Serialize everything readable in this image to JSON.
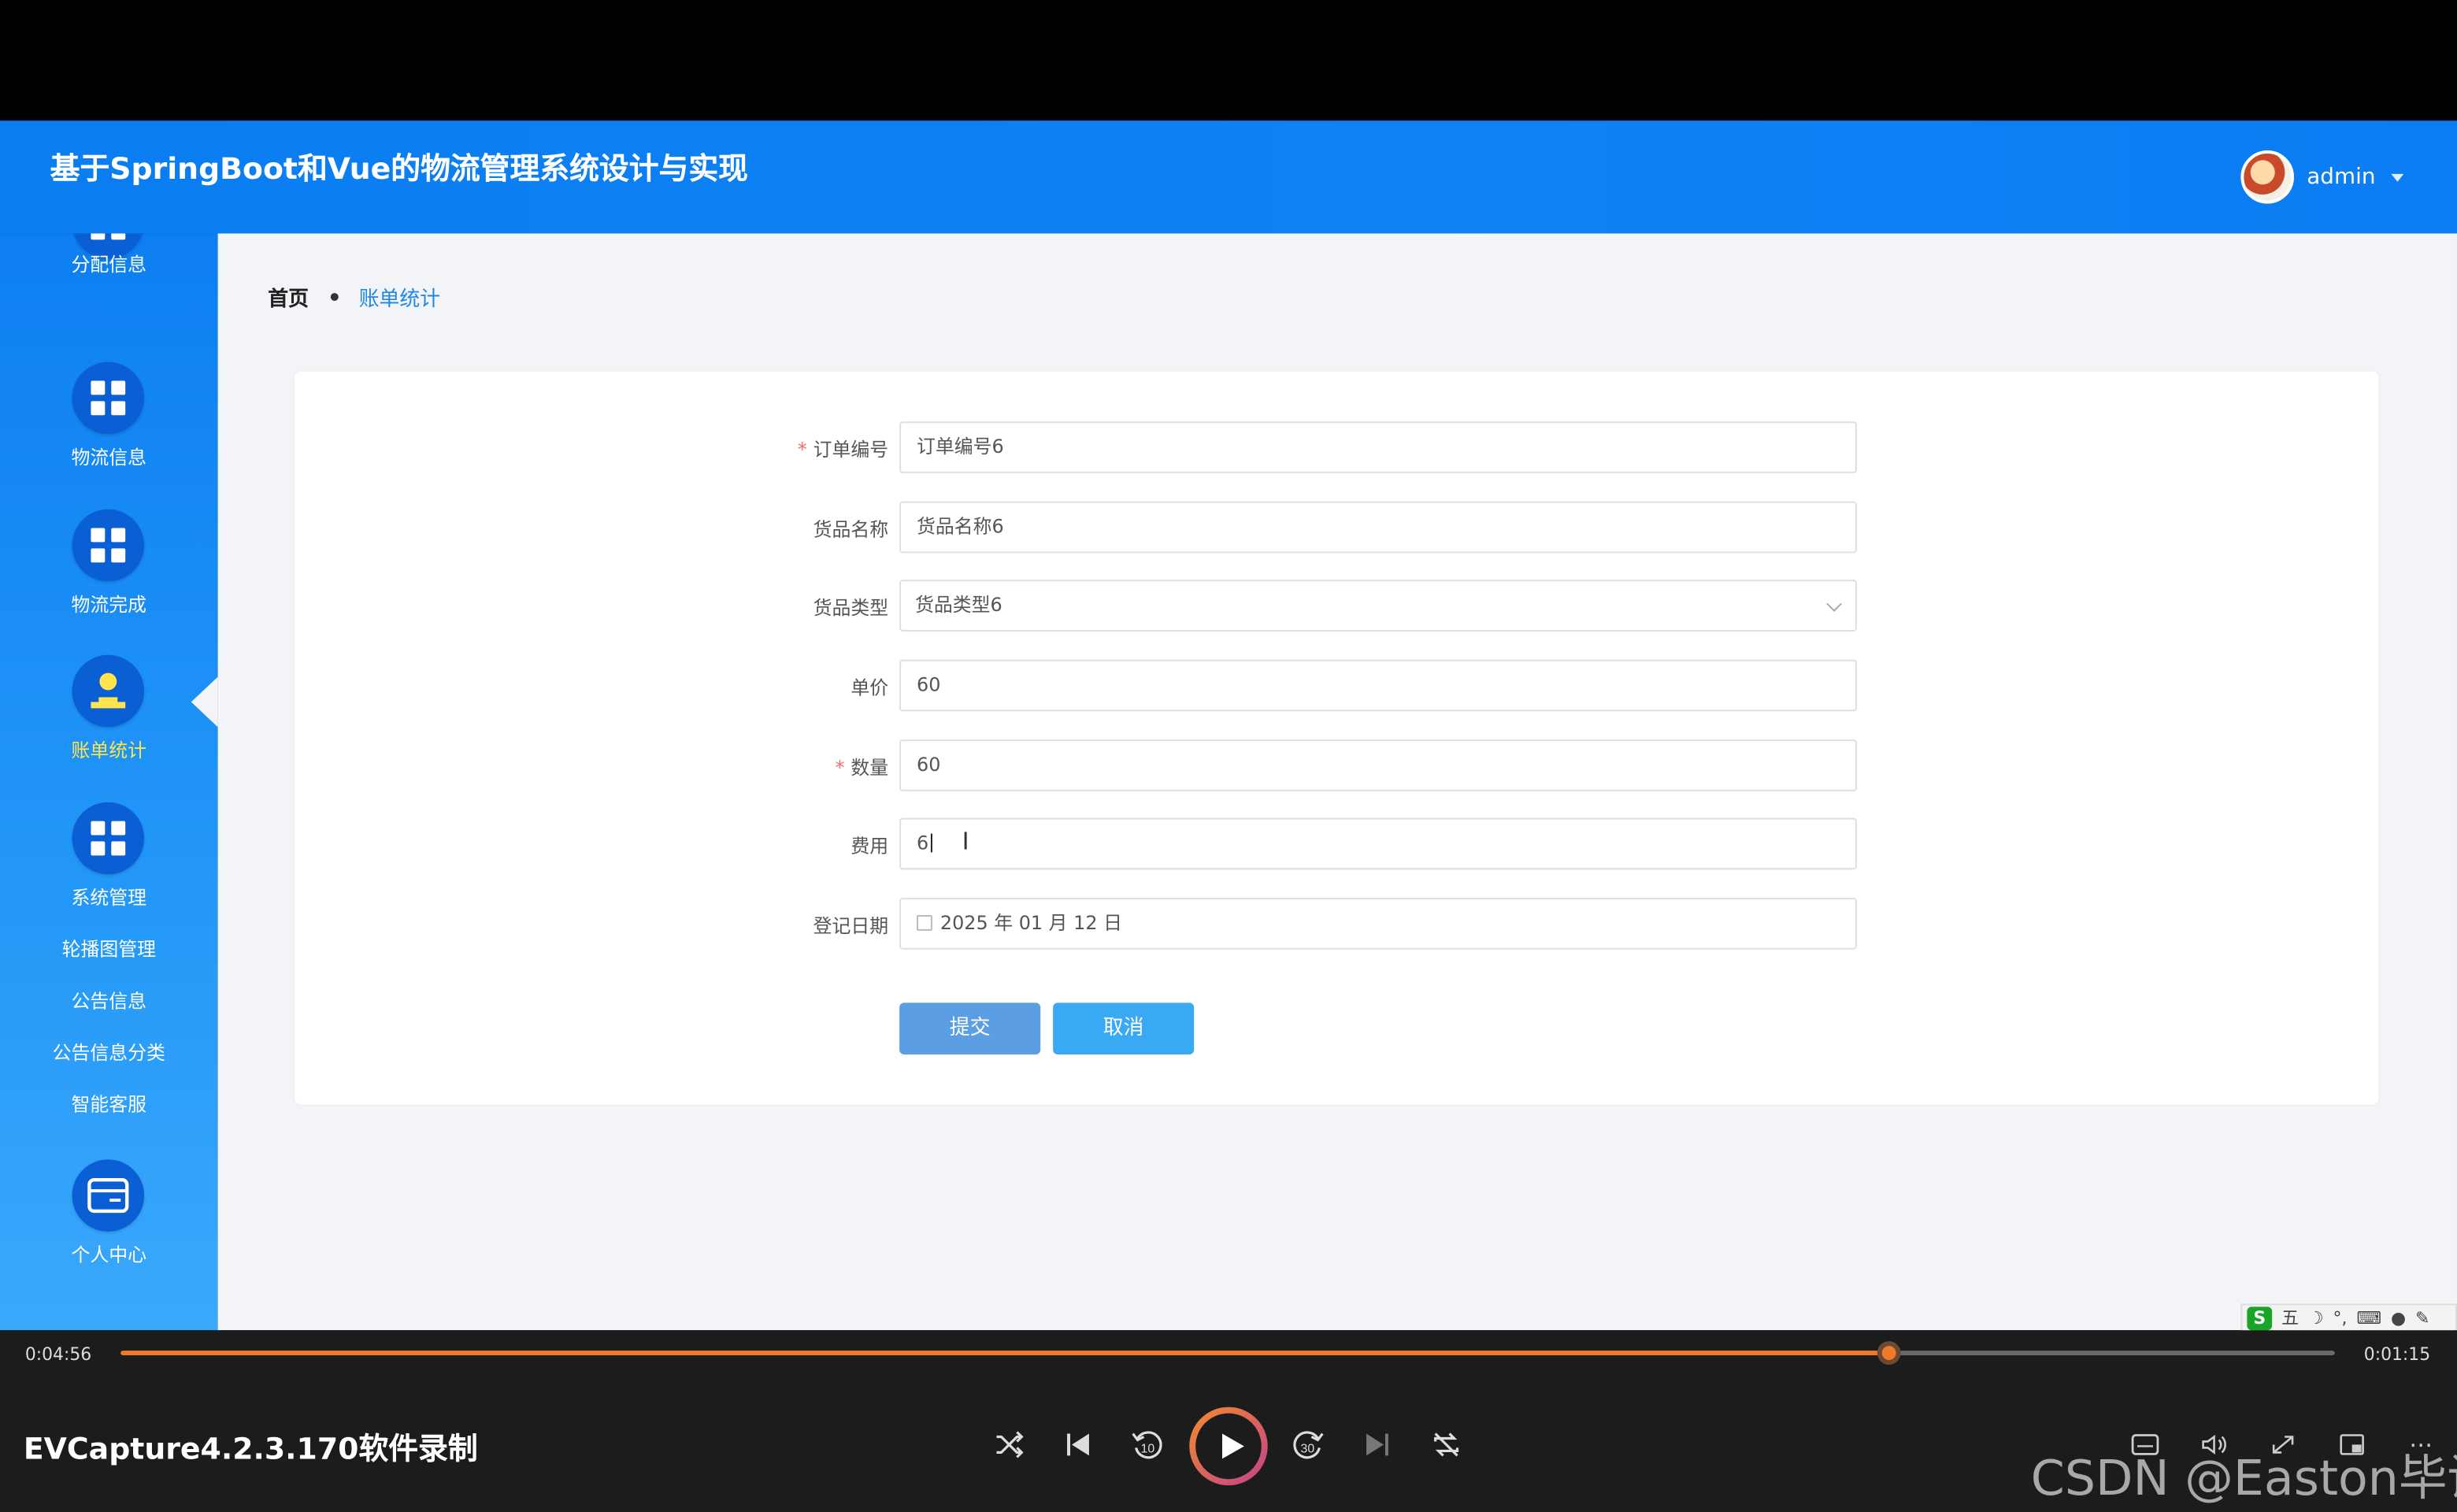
{
  "header": {
    "title": "基于SpringBoot和Vue的物流管理系统设计与实现",
    "username": "admin"
  },
  "sidebar": {
    "items": [
      {
        "label": "分配信息",
        "icon": "grid-icon"
      },
      {
        "label": "物流信息",
        "icon": "grid-icon"
      },
      {
        "label": "物流完成",
        "icon": "grid-icon"
      },
      {
        "label": "账单统计",
        "icon": "user-stamp-icon",
        "active": true
      },
      {
        "label": "系统管理",
        "icon": "grid-icon"
      },
      {
        "label": "个人中心",
        "icon": "card-icon"
      }
    ],
    "sub_items": [
      "轮播图管理",
      "公告信息",
      "公告信息分类",
      "智能客服"
    ]
  },
  "breadcrumb": {
    "home": "首页",
    "current": "账单统计"
  },
  "form": {
    "order_no": {
      "label": "订单编号",
      "value": "订单编号6",
      "required": true
    },
    "goods_name": {
      "label": "货品名称",
      "value": "货品名称6"
    },
    "goods_type": {
      "label": "货品类型",
      "value": "货品类型6"
    },
    "unit_price": {
      "label": "单价",
      "value": "60"
    },
    "quantity": {
      "label": "数量",
      "value": "60",
      "required": true
    },
    "fee": {
      "label": "费用",
      "value": "6"
    },
    "reg_date": {
      "label": "登记日期",
      "value": "2025 年 01 月 12 日"
    },
    "submit_label": "提交",
    "cancel_label": "取消",
    "required_mark": "*"
  },
  "ime": {
    "logo": "S",
    "mode": "五"
  },
  "player": {
    "elapsed": "0:04:56",
    "remaining": "0:01:15",
    "progress_fraction": 0.7985,
    "recorder_label": "EVCapture4.2.3.170软件录制",
    "watermark": "CSDN @Easton毕设",
    "accent_color": "#f07a2a"
  }
}
